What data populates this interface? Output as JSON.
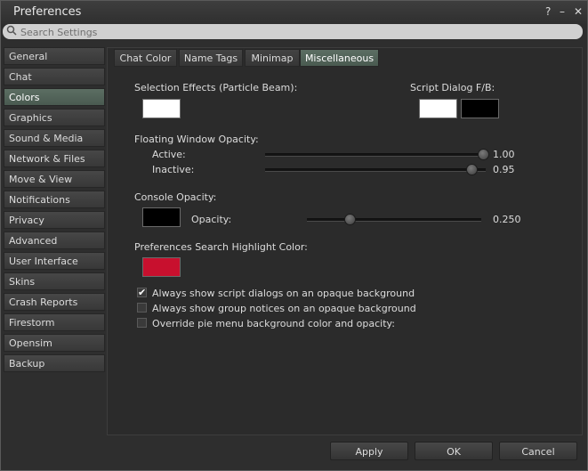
{
  "window": {
    "title": "Preferences",
    "help": "?",
    "minimize": "–",
    "close": "✕"
  },
  "search": {
    "placeholder": "Search Settings"
  },
  "sidebar": {
    "items": [
      {
        "label": "General"
      },
      {
        "label": "Chat"
      },
      {
        "label": "Colors",
        "active": true
      },
      {
        "label": "Graphics"
      },
      {
        "label": "Sound & Media"
      },
      {
        "label": "Network & Files"
      },
      {
        "label": "Move & View"
      },
      {
        "label": "Notifications"
      },
      {
        "label": "Privacy"
      },
      {
        "label": "Advanced"
      },
      {
        "label": "User Interface"
      },
      {
        "label": "Skins"
      },
      {
        "label": "Crash Reports"
      },
      {
        "label": "Firestorm"
      },
      {
        "label": "Opensim"
      },
      {
        "label": "Backup"
      }
    ]
  },
  "tabs": [
    {
      "label": "Chat Color"
    },
    {
      "label": "Name Tags"
    },
    {
      "label": "Minimap"
    },
    {
      "label": "Miscellaneous",
      "active": true
    }
  ],
  "misc": {
    "selection_effects_label": "Selection Effects (Particle Beam):",
    "selection_effects_color": "#ffffff",
    "script_dialog_label": "Script Dialog F/B:",
    "script_dialog_fg": "#ffffff",
    "script_dialog_bg": "#000000",
    "floating_opacity_label": "Floating Window Opacity:",
    "active_label": "Active:",
    "active_value": "1.00",
    "inactive_label": "Inactive:",
    "inactive_value": "0.95",
    "console_opacity_label": "Console Opacity:",
    "console_color": "#000000",
    "opacity_label": "Opacity:",
    "opacity_value": "0.250",
    "highlight_color_label": "Preferences Search Highlight Color:",
    "highlight_color": "#c8102e",
    "checkboxes": [
      {
        "label": "Always show script dialogs on an opaque background",
        "checked": true
      },
      {
        "label": "Always show group notices on an opaque background",
        "checked": false
      },
      {
        "label": "Override pie menu background color and opacity:",
        "checked": false
      }
    ]
  },
  "footer": {
    "apply": "Apply",
    "ok": "OK",
    "cancel": "Cancel"
  }
}
